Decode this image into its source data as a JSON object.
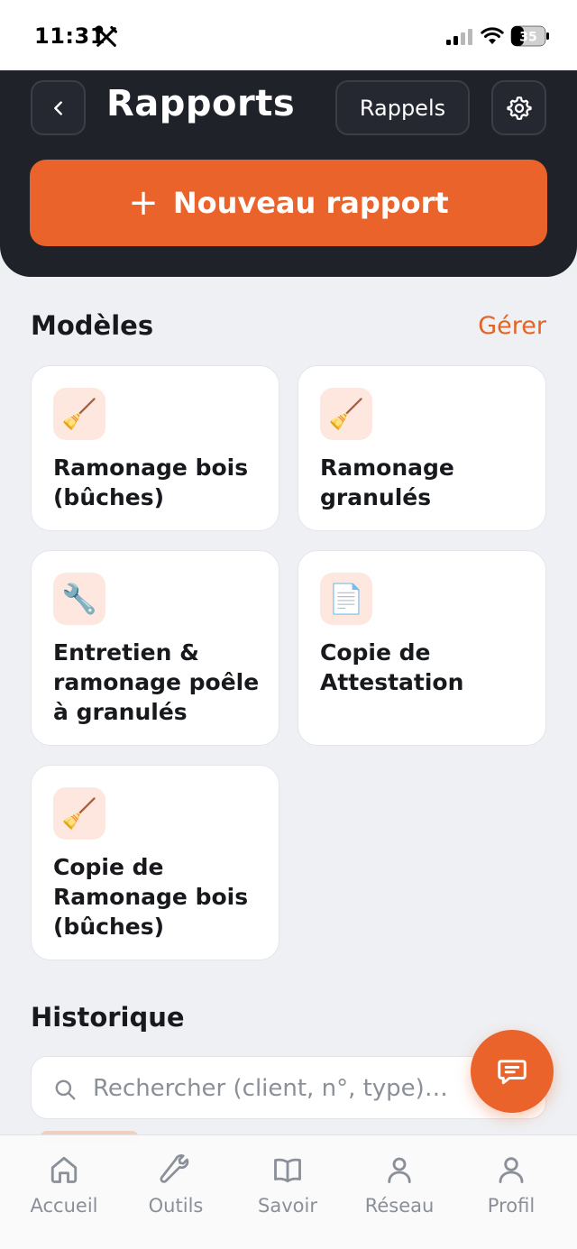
{
  "status_bar": {
    "time": "11:31",
    "battery": "35"
  },
  "header": {
    "title": "Rapports",
    "reminders_label": "Rappels",
    "new_report_plus": "+",
    "new_report_label": "Nouveau rapport"
  },
  "templates": {
    "title": "Modèles",
    "manage_label": "Gérer",
    "items": [
      {
        "label": "Ramonage bois (bûches)",
        "icon": "broom-icon",
        "emoji": "🧹"
      },
      {
        "label": "Ramonage granulés",
        "icon": "broom-icon",
        "emoji": "🧹"
      },
      {
        "label": "Entretien & ramonage poêle à granulés",
        "icon": "wrench-icon",
        "emoji": "🔧"
      },
      {
        "label": "Copie de Attestation",
        "icon": "document-icon",
        "emoji": "📄"
      },
      {
        "label": "Copie de Ramonage bois (bûches)",
        "icon": "broom-icon",
        "emoji": "🧹"
      }
    ]
  },
  "history": {
    "title": "Historique",
    "search_placeholder": "Rechercher (client, n°, type)…"
  },
  "tabs": [
    {
      "label": "Accueil",
      "icon": "home-icon"
    },
    {
      "label": "Outils",
      "icon": "wrench-icon"
    },
    {
      "label": "Savoir",
      "icon": "book-icon"
    },
    {
      "label": "Réseau",
      "icon": "person-icon"
    },
    {
      "label": "Profil",
      "icon": "person-icon"
    }
  ],
  "colors": {
    "accent": "#e9632b",
    "header_bg": "#1f2229",
    "background": "#eef0f3",
    "icon_tile": "#fde7df"
  }
}
